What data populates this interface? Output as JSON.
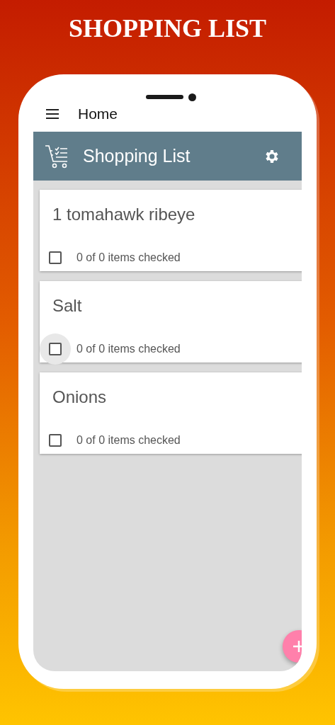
{
  "title": "SHOPPING LIST",
  "phone_header": {
    "label": "Home"
  },
  "app_bar": {
    "title": "Shopping List"
  },
  "lists": [
    {
      "name": "1 tomahawk ribeye",
      "checked": false,
      "focused": false,
      "summary": "0 of 0 items checked"
    },
    {
      "name": "Salt",
      "checked": false,
      "focused": true,
      "summary": "0 of 0 items checked"
    },
    {
      "name": "Onions",
      "checked": false,
      "focused": false,
      "summary": "0 of 0 items checked"
    }
  ]
}
